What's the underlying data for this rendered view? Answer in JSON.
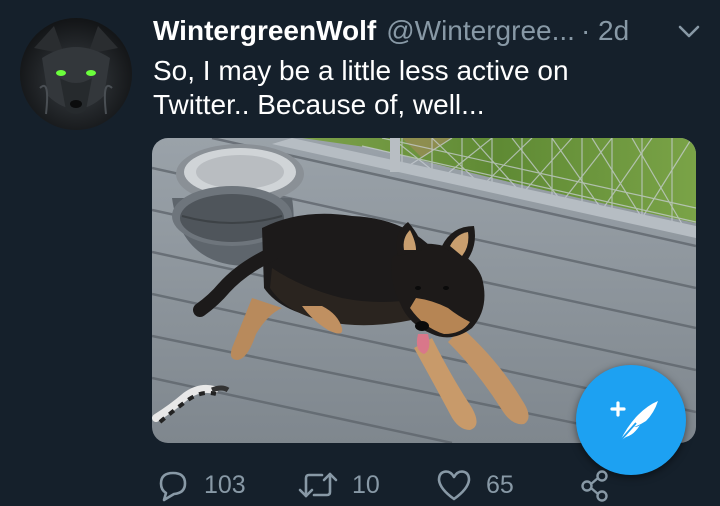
{
  "tweet": {
    "display_name": "WintergreenWolf",
    "handle": "@Wintergree...",
    "time": "· 2d",
    "text_line1": "So, I may be a little less active on",
    "text_line2": "Twitter.. Because of, well..."
  },
  "actions": {
    "replies": "103",
    "retweets": "10",
    "likes": "65"
  },
  "icons": {
    "avatar": "wolf-avatar",
    "caret": "chevron-down-icon",
    "reply": "reply-icon",
    "retweet": "retweet-icon",
    "like": "heart-icon",
    "share": "share-icon",
    "compose": "compose-tweet-icon"
  },
  "colors": {
    "background": "#15202b",
    "secondary_text": "#8899a6",
    "accent": "#1da1f2"
  }
}
